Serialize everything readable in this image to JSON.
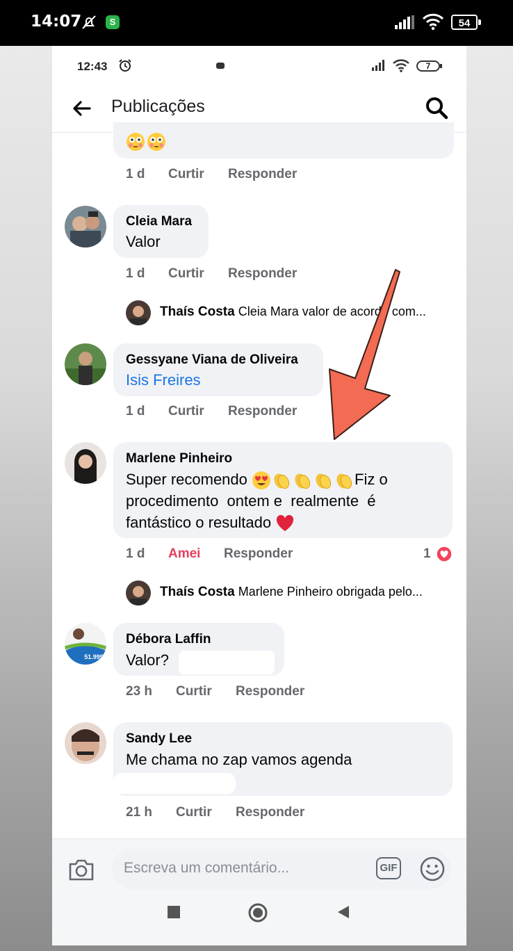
{
  "outer_status": {
    "time": "14:07",
    "battery": "54",
    "wa_icon": "S"
  },
  "inner_status": {
    "time": "12:43",
    "battery": "7"
  },
  "header": {
    "title": "Publicações"
  },
  "partial_comment": {
    "meta": {
      "time": "1 d",
      "like": "Curtir",
      "reply": "Responder"
    }
  },
  "comments": [
    {
      "name": "Cleia Mara",
      "text": "Valor",
      "meta": {
        "time": "1 d",
        "like": "Curtir",
        "reply": "Responder"
      }
    },
    {
      "name": "Gessyane Viana de Oliveira",
      "mention": "Isis Freires",
      "meta": {
        "time": "1 d",
        "like": "Curtir",
        "reply": "Responder"
      }
    },
    {
      "name": "Marlene Pinheiro",
      "text_line1": "Super recomendo",
      "text_line1b": "Fiz o",
      "text_line2": "procedimento  ontem e  realmente  é",
      "text_line3": "fantástico o resultado",
      "meta": {
        "time": "1 d",
        "like": "Amei",
        "reply": "Responder",
        "reactions": "1"
      }
    },
    {
      "name": "Débora Laffin",
      "text": "Valor?",
      "meta": {
        "time": "23 h",
        "like": "Curtir",
        "reply": "Responder"
      }
    },
    {
      "name": "Sandy Lee",
      "text": "Me chama no zap vamos agenda",
      "meta": {
        "time": "21 h",
        "like": "Curtir",
        "reply": "Responder"
      }
    }
  ],
  "replies": [
    {
      "author": "Thaís Costa",
      "preview": "Cleia Mara valor de acordo com..."
    },
    {
      "author": "Thaís Costa",
      "preview": "Marlene Pinheiro obrigada pelo..."
    }
  ],
  "avatar_badge": {
    "price": "51.999"
  },
  "composer": {
    "placeholder": "Escreva um comentário...",
    "gif_label": "GIF"
  },
  "colors": {
    "accent_blue": "#1b74e4",
    "love_red": "#e4405f",
    "bubble": "#f0f2f5",
    "arrow": "#f26b52"
  }
}
